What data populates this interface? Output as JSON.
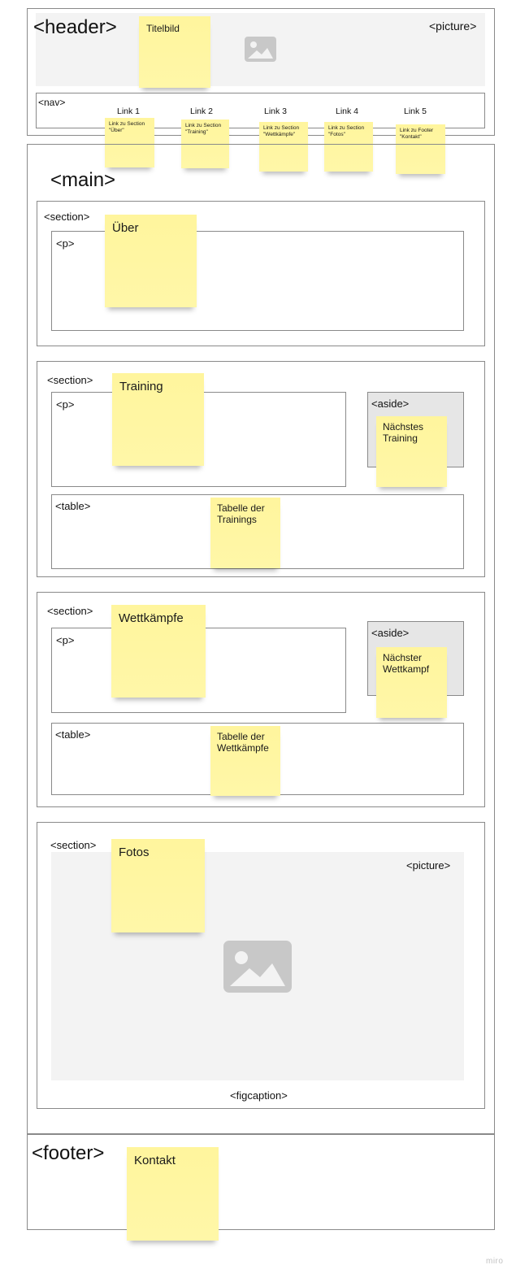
{
  "header": {
    "tag": "<header>",
    "picture_tag": "<picture>",
    "title_note": "Titelbild",
    "image_icon": "image-placeholder-icon"
  },
  "nav": {
    "tag": "<nav>",
    "links": [
      {
        "label": "Link 1",
        "note": "Link zu Section \"Über\""
      },
      {
        "label": "Link 2",
        "note": "Link zu Section \"Training\""
      },
      {
        "label": "Link 3",
        "note": "Link zu Section \"Wettkämpfe\""
      },
      {
        "label": "Link 4",
        "note": "Link zu Section \"Fotos\""
      },
      {
        "label": "Link 5",
        "note": "Link zu Footer \"Kontakt\""
      }
    ]
  },
  "main": {
    "tag": "<main>",
    "sections": {
      "ueber": {
        "section_tag": "<section>",
        "p_tag": "<p>",
        "note": "Über"
      },
      "training": {
        "section_tag": "<section>",
        "p_tag": "<p>",
        "note": "Training",
        "aside_tag": "<aside>",
        "aside_note": "Nächstes Training",
        "table_tag": "<table>",
        "table_note": "Tabelle der Trainings"
      },
      "wettkaempfe": {
        "section_tag": "<section>",
        "p_tag": "<p>",
        "note": "Wettkämpfe",
        "aside_tag": "<aside>",
        "aside_note": "Nächster Wettkampf",
        "table_tag": "<table>",
        "table_note": "Tabelle der Wettkämpfe"
      },
      "fotos": {
        "section_tag": "<section>",
        "picture_tag": "<picture>",
        "note": "Fotos",
        "figcaption_tag": "<figcaption>",
        "image_icon": "image-placeholder-icon"
      }
    }
  },
  "footer": {
    "tag": "<footer>",
    "note": "Kontakt"
  },
  "watermark": "miro",
  "colors": {
    "sticky": "#fff59d",
    "border": "#8a8a8a",
    "placeholder": "#f3f3f3",
    "aside": "#e6e6e6",
    "icon": "#c8c8c8"
  }
}
